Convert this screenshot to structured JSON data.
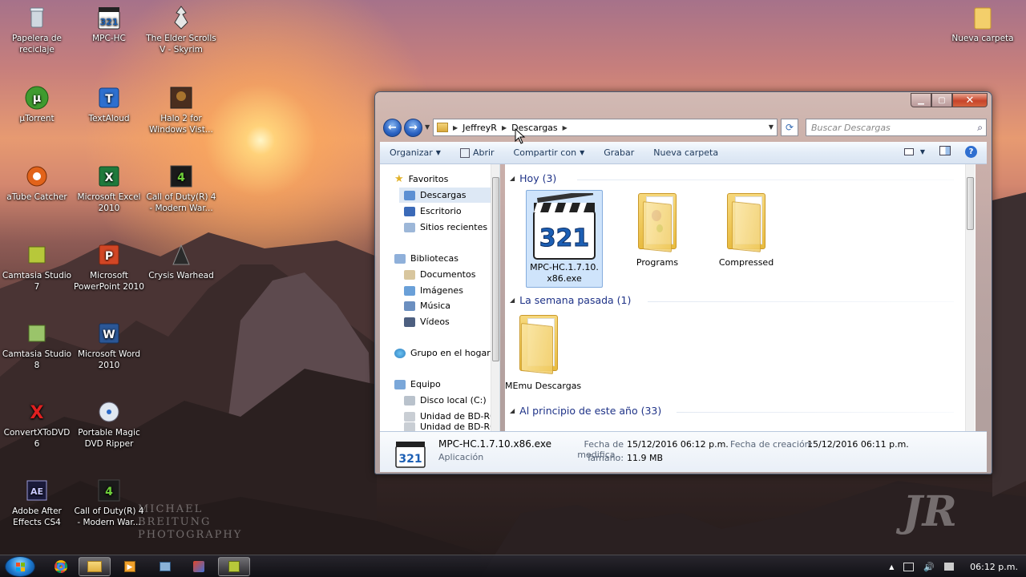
{
  "desktop": {
    "icons": [
      {
        "label": "Papelera de reciclaje",
        "icon": "recycle-bin-icon"
      },
      {
        "label": "MPC-HC",
        "icon": "mpc-hc-icon"
      },
      {
        "label": "The Elder Scrolls V - Skyrim",
        "icon": "skyrim-icon"
      },
      {
        "label": "µTorrent",
        "icon": "utorrent-icon"
      },
      {
        "label": "TextAloud",
        "icon": "textaloud-icon"
      },
      {
        "label": "Halo 2 for Windows Vist...",
        "icon": "halo-icon"
      },
      {
        "label": "aTube Catcher",
        "icon": "atube-catcher-icon"
      },
      {
        "label": "Microsoft Excel 2010",
        "icon": "excel-icon"
      },
      {
        "label": "Call of Duty(R) 4 - Modern War...",
        "icon": "call-of-duty-icon"
      },
      {
        "label": "Camtasia Studio 7",
        "icon": "camtasia-icon"
      },
      {
        "label": "Microsoft PowerPoint 2010",
        "icon": "powerpoint-icon"
      },
      {
        "label": "Crysis Warhead",
        "icon": "crysis-icon"
      },
      {
        "label": "Camtasia Studio 8",
        "icon": "camtasia-icon"
      },
      {
        "label": "Microsoft Word 2010",
        "icon": "word-icon"
      },
      {
        "label": "ConvertXToDVD 6",
        "icon": "convertxtodvd-icon"
      },
      {
        "label": "Portable Magic DVD Ripper",
        "icon": "dvd-ripper-icon"
      },
      {
        "label": "Adobe After Effects CS4",
        "icon": "after-effects-icon"
      },
      {
        "label": "Call of Duty(R) 4 - Modern War...",
        "icon": "call-of-duty-icon"
      },
      {
        "label": "Nueva carpeta",
        "icon": "folder-icon"
      }
    ]
  },
  "window": {
    "address": {
      "crumbs": [
        "JeffreyR",
        "Descargas"
      ]
    },
    "search_placeholder": "Buscar Descargas",
    "toolbar": {
      "organize": "Organizar",
      "open": "Abrir",
      "share": "Compartir con",
      "burn": "Grabar",
      "new_folder": "Nueva carpeta"
    },
    "nav": {
      "favorites": "Favoritos",
      "downloads": "Descargas",
      "desktop": "Escritorio",
      "recent": "Sitios recientes",
      "libraries": "Bibliotecas",
      "documents": "Documentos",
      "images": "Imágenes",
      "music": "Música",
      "videos": "Vídeos",
      "homegroup": "Grupo en el hogar",
      "computer": "Equipo",
      "local_disk": "Disco local (C:)",
      "bdrom": "Unidad de BD-ROM (",
      "bdrom2": "Unidad de BD-ROM"
    },
    "groups": {
      "today": "Hoy (3)",
      "last_week": "La semana pasada (1)",
      "earlier_year": "Al principio de este año (33)"
    },
    "files": {
      "mpc_name": "MPC-HC.1.7.10.x86.exe",
      "programs": "Programs",
      "compressed": "Compressed",
      "memu": "MEmu Descargas"
    },
    "details": {
      "filename": "MPC-HC.1.7.10.x86.exe",
      "type": "Aplicación",
      "modified_label": "Fecha de modifica...",
      "modified_value": "15/12/2016 06:12 p.m.",
      "size_label": "Tamaño:",
      "size_value": "11.9 MB",
      "created_label": "Fecha de creación:",
      "created_value": "15/12/2016 06:11 p.m."
    }
  },
  "taskbar": {
    "clock": "06:12 p.m.",
    "apps": [
      "start-orb",
      "chrome-icon",
      "explorer-icon",
      "media-player-icon",
      "network-icon",
      "paint-icon",
      "camtasia-icon"
    ]
  },
  "watermark": {
    "photo_credit": "MICHAEL BREITUNG PHOTOGRAPHY",
    "logo": "JR"
  }
}
